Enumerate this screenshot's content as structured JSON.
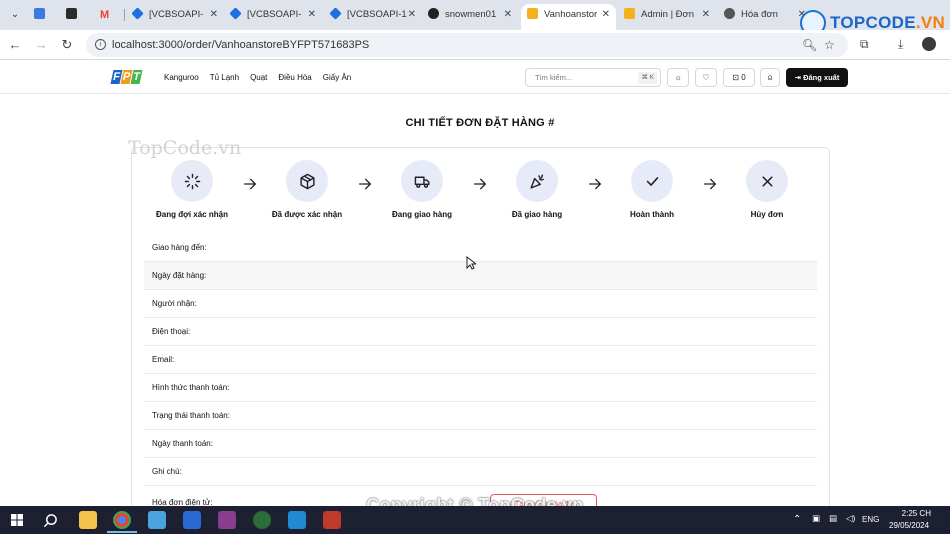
{
  "browser": {
    "tabs": [
      {
        "label": "",
        "color": "#3c79e6"
      },
      {
        "label": "",
        "color": "#2b2b2b"
      },
      {
        "label": "M",
        "color": "#ea4335"
      },
      {
        "label": "[VCBSOAPI-",
        "color": "#1f6fe0"
      },
      {
        "label": "[VCBSOAPI-",
        "color": "#1f6fe0"
      },
      {
        "label": "[VCBSOAPI-1",
        "color": "#1f6fe0"
      },
      {
        "label": "snowmen01",
        "color": "#222222"
      },
      {
        "label": "Vanhoanstor",
        "color": "#f3b21d"
      },
      {
        "label": "Admin | Đơn",
        "color": "#f3b21d"
      },
      {
        "label": "Hóa đơn",
        "color": "#555555"
      }
    ],
    "url": "localhost:3000/order/VanhoanstoreBYFPT571683PS",
    "watermark_logo": {
      "main": "TOPCODE",
      "suffix": ".VN"
    }
  },
  "header": {
    "logo_letters": [
      "F",
      "P",
      "T"
    ],
    "logo_colors": [
      "#1d63c5",
      "#f39a1e",
      "#45b649"
    ],
    "nav": [
      "Kanguroo",
      "Tủ Lạnh",
      "Quạt",
      "Điều Hòa",
      "Giấy Ăn"
    ],
    "search_placeholder": "Tìm kiếm...",
    "search_shortcut": "⌘ K",
    "cart_count": "0",
    "logout_label": "Đăng xuất"
  },
  "main": {
    "title": "CHI TIẾT ĐƠN ĐẶT HÀNG #",
    "watermark": "TopCode.vn",
    "steps": [
      {
        "label": "Đang đợi xác nhận",
        "icon": "loader-icon"
      },
      {
        "label": "Đã được xác nhận",
        "icon": "package-icon"
      },
      {
        "label": "Đang giao hàng",
        "icon": "truck-icon"
      },
      {
        "label": "Đã giao hàng",
        "icon": "party-popper-icon"
      },
      {
        "label": "Hoàn thành",
        "icon": "check-icon"
      },
      {
        "label": "Hủy đơn",
        "icon": "x-icon"
      }
    ],
    "fields": [
      "Giao hàng đến:",
      "Ngày đặt hàng:",
      "Người nhận:",
      "Điện thoại:",
      "Email:",
      "Hình thức thanh toán:",
      "Trạng thái thanh toán:",
      "Ngày thanh toán:",
      "Ghi chú:",
      "Hóa đơn điện tử:"
    ],
    "invoice_button": "Tải xuống hóa đơn"
  },
  "overlay": {
    "copyright": "Copyright © TopCode.vn"
  },
  "taskbar": {
    "lang": "ENG",
    "time": "2:25 CH",
    "date": "29/05/2024"
  }
}
